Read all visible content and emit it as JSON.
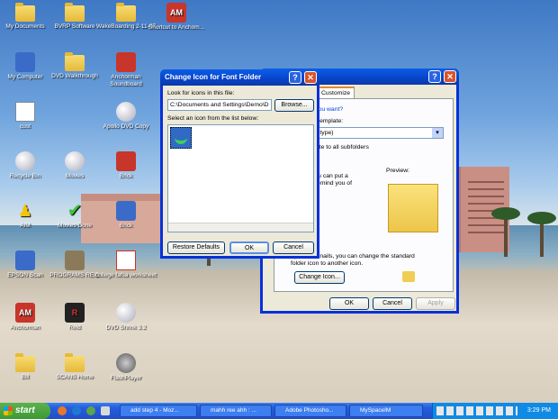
{
  "desktop": {
    "icons": [
      {
        "label": "My Documents",
        "icon": "folder-docs-icon"
      },
      {
        "label": "BVRP Software",
        "icon": "folder-icon"
      },
      {
        "label": "WakeBoarding 2-11-07",
        "icon": "folder-icon"
      },
      {
        "label": "Shortcut to Anchom...",
        "icon": "am-shortcut-icon"
      },
      {
        "label": "My Computer",
        "icon": "computer-icon"
      },
      {
        "label": "DVD Walkthrough",
        "icon": "folder-icon"
      },
      {
        "label": "Anchorman Soundboard",
        "icon": "app-icon"
      },
      {
        "label": "cust",
        "icon": "document-icon"
      },
      {
        "label": "Apollo DVD Copy",
        "icon": "apollo-icon"
      },
      {
        "label": "Recycle Bin",
        "icon": "recycle-bin-icon"
      },
      {
        "label": "Movies",
        "icon": "disc-icon"
      },
      {
        "label": "Brick",
        "icon": "app-icon"
      },
      {
        "label": "AIM",
        "icon": "aim-icon"
      },
      {
        "label": "Movies Done",
        "icon": "checkmark-icon"
      },
      {
        "label": "Brick",
        "icon": "app-icon"
      },
      {
        "label": "EPSON Scan",
        "icon": "scanner-icon"
      },
      {
        "label": "PROGRAMS REID",
        "icon": "reid-icon"
      },
      {
        "label": "college fafsa worksheet",
        "icon": "pdf-icon"
      },
      {
        "label": "Anchorman",
        "icon": "am-icon"
      },
      {
        "label": "Reid",
        "icon": "reid-logo-icon"
      },
      {
        "label": "DVD Shrink 3.2",
        "icon": "dvd-shrink-icon"
      },
      {
        "label": "Bill",
        "icon": "folder-icon"
      },
      {
        "label": "SCANS Home",
        "icon": "folder-icon"
      },
      {
        "label": "FlashPlayer",
        "icon": "flash-icon"
      }
    ]
  },
  "props": {
    "tab": "Customize",
    "group_q": "der do you want?",
    "template_lbl": "pe as a template:",
    "template_val": "any file type)",
    "apply_all": "s template to all subfolders",
    "preview_text": "view, you can put a\nlder to remind you of",
    "preview_lbl": "Preview:",
    "icons_text": "ept Thumbnails, you can change the standard\nfolder  icon to another icon.",
    "change_icon": "Change Icon...",
    "ok": "OK",
    "cancel": "Cancel",
    "apply": "Apply"
  },
  "dialog": {
    "title": "Change Icon for Font Folder",
    "look_lbl": "Look for icons in this file:",
    "path": "C:\\Documents and Settings\\Demo\\D",
    "browse": "Browse...",
    "select_lbl": "Select an icon from the list below:",
    "restore": "Restore Defaults",
    "ok": "OK",
    "cancel": "Cancel"
  },
  "taskbar": {
    "start": "start",
    "tasks": [
      "add step 4 - Moz...",
      "mahh ree ahh : ...",
      "Adobe Photosho...",
      "MySpaceIM"
    ],
    "clock": "3:29 PM"
  },
  "colors": {
    "accent": "#0831d9",
    "start": "#3c9a33"
  }
}
